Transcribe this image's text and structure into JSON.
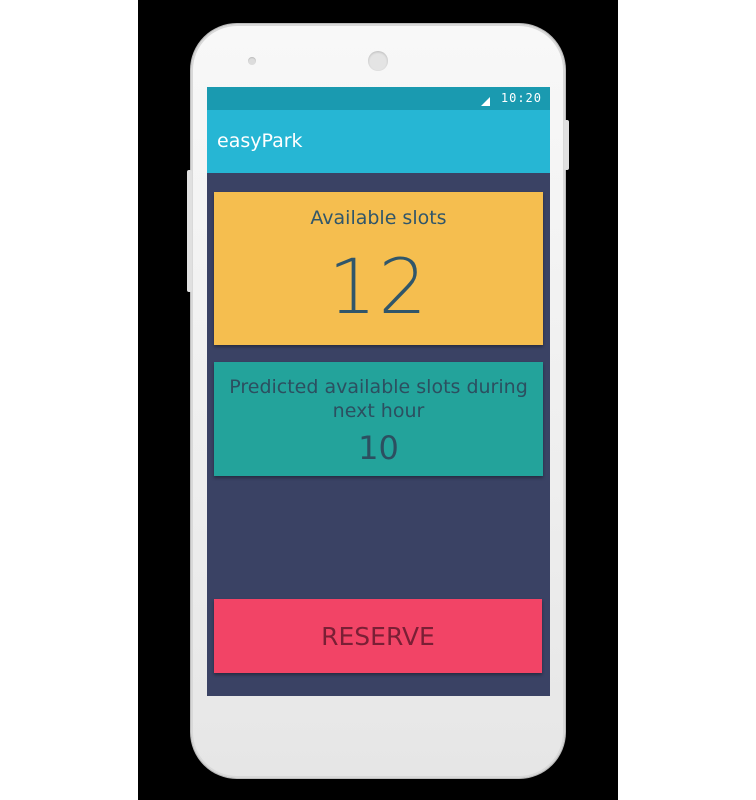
{
  "status_bar": {
    "time": "10:20"
  },
  "app_bar": {
    "title": "easyPark"
  },
  "available_card": {
    "label": "Available slots",
    "value": "12"
  },
  "predicted_card": {
    "label": "Predicted available slots during next hour",
    "value": "10"
  },
  "reserve_button": {
    "label": "RESERVE"
  },
  "colors": {
    "status_bar": "#1a9ab0",
    "app_bar": "#26b6d4",
    "screen_background": "#3a4264",
    "available_card": "#f5be4f",
    "predicted_card": "#23a39b",
    "reserve_button": "#f24466"
  },
  "icons": {
    "signal": "signal-icon"
  }
}
